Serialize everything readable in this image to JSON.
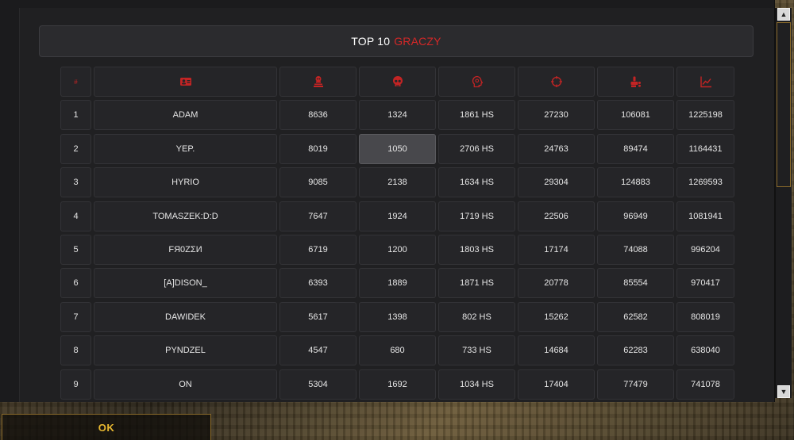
{
  "title": {
    "prefix": "TOP 10",
    "accent": "GRACZY"
  },
  "header": {
    "rank": "#",
    "icons": [
      "player-card-icon",
      "skull-tombstone-icon",
      "skull-icon",
      "head-target-icon",
      "crosshair-icon",
      "hand-coins-icon",
      "chart-icon"
    ]
  },
  "rows": [
    {
      "rank": "1",
      "name": "ADAM",
      "c1": "8636",
      "c2": "1324",
      "c3": "1861 HS",
      "c4": "27230",
      "c5": "106081",
      "c6": "1225198"
    },
    {
      "rank": "2",
      "name": "YEP.",
      "c1": "8019",
      "c2": "1050",
      "c3": "2706 HS",
      "c4": "24763",
      "c5": "89474",
      "c6": "1164431"
    },
    {
      "rank": "3",
      "name": "HYRIO",
      "c1": "9085",
      "c2": "2138",
      "c3": "1634 HS",
      "c4": "29304",
      "c5": "124883",
      "c6": "1269593"
    },
    {
      "rank": "4",
      "name": "TOMASZEK:D:D",
      "c1": "7647",
      "c2": "1924",
      "c3": "1719 HS",
      "c4": "22506",
      "c5": "96949",
      "c6": "1081941"
    },
    {
      "rank": "5",
      "name": "FЯ0ZΣИ",
      "c1": "6719",
      "c2": "1200",
      "c3": "1803 HS",
      "c4": "17174",
      "c5": "74088",
      "c6": "996204"
    },
    {
      "rank": "6",
      "name": "[A]DISON_",
      "c1": "6393",
      "c2": "1889",
      "c3": "1871 HS",
      "c4": "20778",
      "c5": "85554",
      "c6": "970417"
    },
    {
      "rank": "7",
      "name": "DAWIDEK",
      "c1": "5617",
      "c2": "1398",
      "c3": "802 HS",
      "c4": "15262",
      "c5": "62582",
      "c6": "808019"
    },
    {
      "rank": "8",
      "name": "PYNDZEL",
      "c1": "4547",
      "c2": "680",
      "c3": "733 HS",
      "c4": "14684",
      "c5": "62283",
      "c6": "638040"
    },
    {
      "rank": "9",
      "name": "ON",
      "c1": "5304",
      "c2": "1692",
      "c3": "1034 HS",
      "c4": "17404",
      "c5": "77479",
      "c6": "741078"
    }
  ],
  "scrollbar": {
    "up": "▲",
    "down": "▼"
  },
  "ok_label": "OK",
  "colors": {
    "accent": "#d32828",
    "ok_text": "#e8b830",
    "border_gold": "#8a6a2a"
  }
}
